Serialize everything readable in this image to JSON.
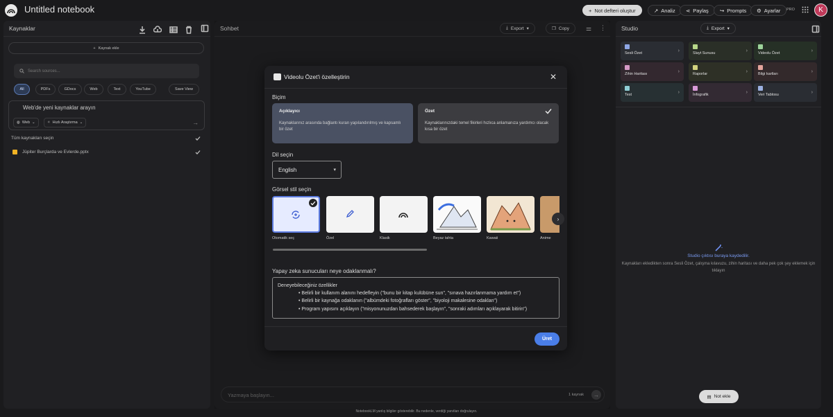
{
  "app": {
    "notebook_title": "Untitled notebook",
    "avatar_initial": "K",
    "pro_badge": "PRO"
  },
  "topbar": {
    "create_notebook": "Not defteri oluştur",
    "analyze": "Analiz",
    "share": "Paylaş",
    "prompts": "Prompts",
    "settings": "Ayarlar"
  },
  "sources": {
    "title": "Kaynaklar",
    "add_source": "Kaynak ekle",
    "search_placeholder": "Search sources...",
    "filters": [
      "All",
      "PDFs",
      "GDocs",
      "Web",
      "Text",
      "YouTube"
    ],
    "save_view": "Save View",
    "web_search_placeholder": "Web'de yeni kaynaklar arayın",
    "web_chip": "Web",
    "research_chip": "Hızlı Araştırma",
    "select_all": "Tüm kaynakları seçin",
    "items": [
      {
        "name": "Jüpiter Burçlarda ve Evlerde.pptx"
      }
    ]
  },
  "chat": {
    "title": "Sohbet",
    "export": "Export",
    "copy": "Copy",
    "input_placeholder": "Yazmaya başlayın...",
    "source_count": "1 kaynak"
  },
  "modal": {
    "title": "Videolu Özet'i özelleştirin",
    "format_label": "Biçim",
    "formats": [
      {
        "title": "Açıklayıcı",
        "desc": "Kaynaklarınız arasında bağlantı kuran yapılandırılmış ve kapsamlı bir özet"
      },
      {
        "title": "Özet",
        "desc": "Kaynaklarınızdaki temel fikirleri hızlıca anlamanıza yardımcı olacak kısa bir özet"
      }
    ],
    "language_label": "Dil seçin",
    "language_value": "English",
    "style_label": "Görsel stil seçin",
    "styles": [
      "Otomatik seç",
      "Özel",
      "Klasik",
      "Beyaz tahta",
      "Kawaii",
      "Anime"
    ],
    "focus_label": "Yapay zeka sunucuları neye odaklanmalı?",
    "focus_intro": "Deneyebileceğiniz özellikler",
    "focus_items": [
      "Belirli bir kullanım alanını hedefleyin (\"bunu bir kitap kulübüne sun\", \"sınava hazırlanmama yardım et\")",
      "Belirli bir kaynağa odaklanın (\"albümdeki fotoğrafları göster\", \"biyoloji makalesine odaklan\")",
      "Program yapısını açıklayın (\"misyonunuzdan bahsederek başlayın\", \"sonraki adımları açıklayarak bitirin\")"
    ],
    "generate": "Üret"
  },
  "studio": {
    "title": "Studio",
    "export": "Export",
    "tiles": [
      {
        "label": "Sesli Özet",
        "color": "#2a2d33",
        "icon_color": "#8ea7e6"
      },
      {
        "label": "Slayt Sunusu",
        "color": "#2a2f27",
        "icon_color": "#b8d98a"
      },
      {
        "label": "Videolu Özet",
        "color": "#263026",
        "icon_color": "#9dd39a"
      },
      {
        "label": "Zihin Haritası",
        "color": "#33282f",
        "icon_color": "#d69ac6"
      },
      {
        "label": "Raporlar",
        "color": "#2e3026",
        "icon_color": "#d2d27f"
      },
      {
        "label": "Bilgi kartları",
        "color": "#33292b",
        "icon_color": "#e3a49c"
      },
      {
        "label": "Test",
        "color": "#273033",
        "icon_color": "#8fcfd6"
      },
      {
        "label": "İnfografik",
        "color": "#332a33",
        "icon_color": "#d89ad8"
      },
      {
        "label": "Veri Tablosu",
        "color": "#2a2d33",
        "icon_color": "#9bb0e0"
      }
    ],
    "empty_title": "Studio çıktısı buraya kaydedilir.",
    "empty_desc": "Kaynakları ekledikten sonra Sesli Özet, çalışma kılavuzu, zihin haritası ve daha pek çok şey eklemek için tıklayın",
    "add_note": "Not ekle"
  },
  "footer": "NotebookLM yanlış bilgiler gösterebilir. Bu nedenle, verdiği yanıtları doğrulayın."
}
